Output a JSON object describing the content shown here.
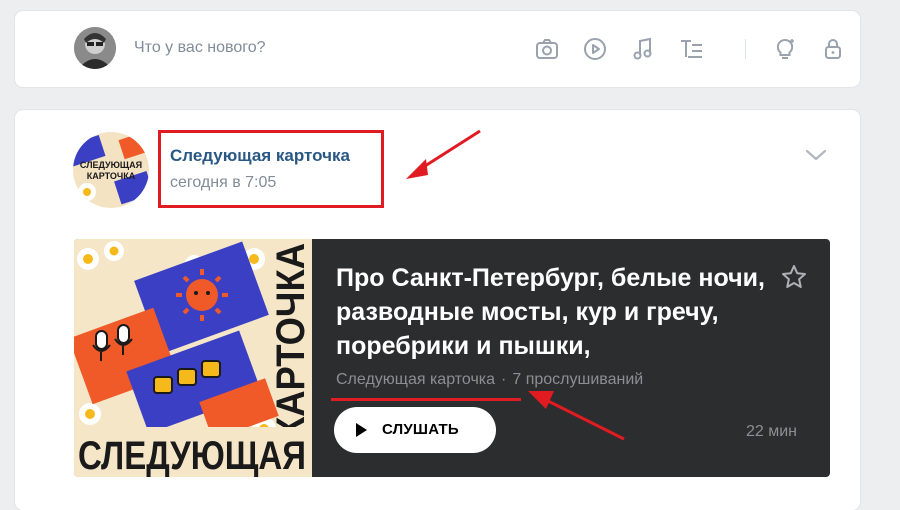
{
  "composer": {
    "placeholder": "Что у вас нового?",
    "tools": [
      "camera-icon",
      "video-icon",
      "music-icon",
      "text-format-icon",
      "ideas-icon",
      "lock-icon"
    ]
  },
  "post": {
    "author": "Следующая карточка",
    "time": "сегодня в 7:05",
    "podcast": {
      "title": "Про Санкт-Петербург, белые ночи, разводные мосты, кур и гречу, поребрики и пышки,",
      "channel": "Следующая карточка",
      "separator": "·",
      "listens": "7 прослушиваний",
      "listen_label": "СЛУШАТЬ",
      "duration": "22 мин",
      "cover_text_vertical": "КАРТОЧКА",
      "cover_text_horizontal": "СЛЕДУЮЩАЯ"
    }
  },
  "colors": {
    "page_bg": "#edeef0",
    "link": "#2a5885",
    "highlight_red": "#e11b22",
    "podcast_bg": "#2c2d2e"
  }
}
